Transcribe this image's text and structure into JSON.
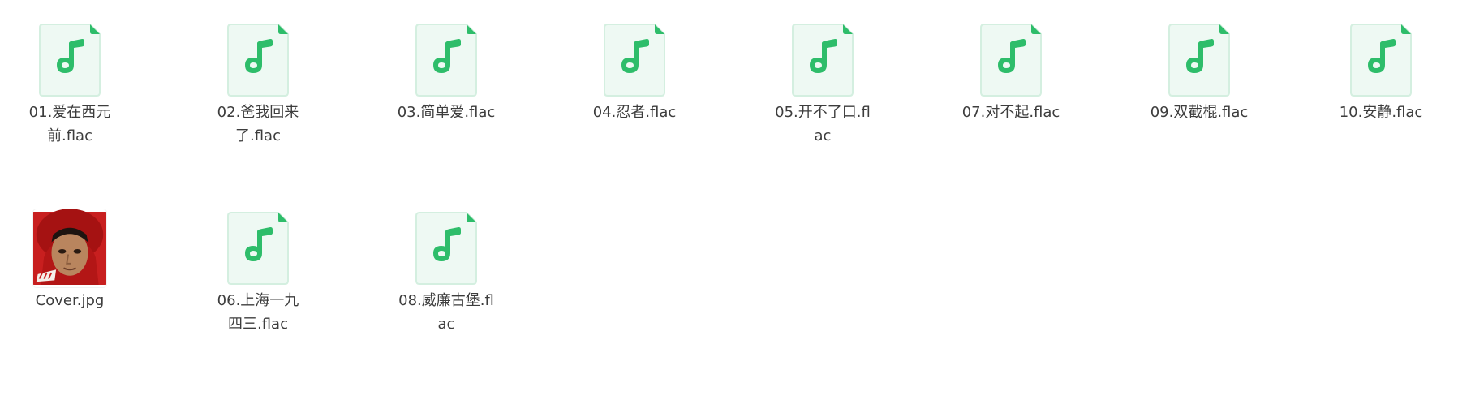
{
  "files": [
    {
      "name": "01.爱在西元前.flac",
      "type": "audio"
    },
    {
      "name": "02.爸我回来了.flac",
      "type": "audio"
    },
    {
      "name": "03.简单爱.flac",
      "type": "audio"
    },
    {
      "name": "04.忍者.flac",
      "type": "audio"
    },
    {
      "name": "05.开不了口.flac",
      "type": "audio"
    },
    {
      "name": "07.对不起.flac",
      "type": "audio"
    },
    {
      "name": "09.双截棍.flac",
      "type": "audio"
    },
    {
      "name": "10.安静.flac",
      "type": "audio"
    },
    {
      "name": "Cover.jpg",
      "type": "image"
    },
    {
      "name": "06.上海一九四三.flac",
      "type": "audio"
    },
    {
      "name": "08.威廉古堡.flac",
      "type": "audio"
    }
  ],
  "colors": {
    "accent": "#2ebd6a",
    "icon_bg": "#eef9f3",
    "icon_border": "#d4efe0",
    "text": "#3d3d3d"
  },
  "icons": {
    "audio": "music-file-icon",
    "image": "image-thumbnail"
  }
}
